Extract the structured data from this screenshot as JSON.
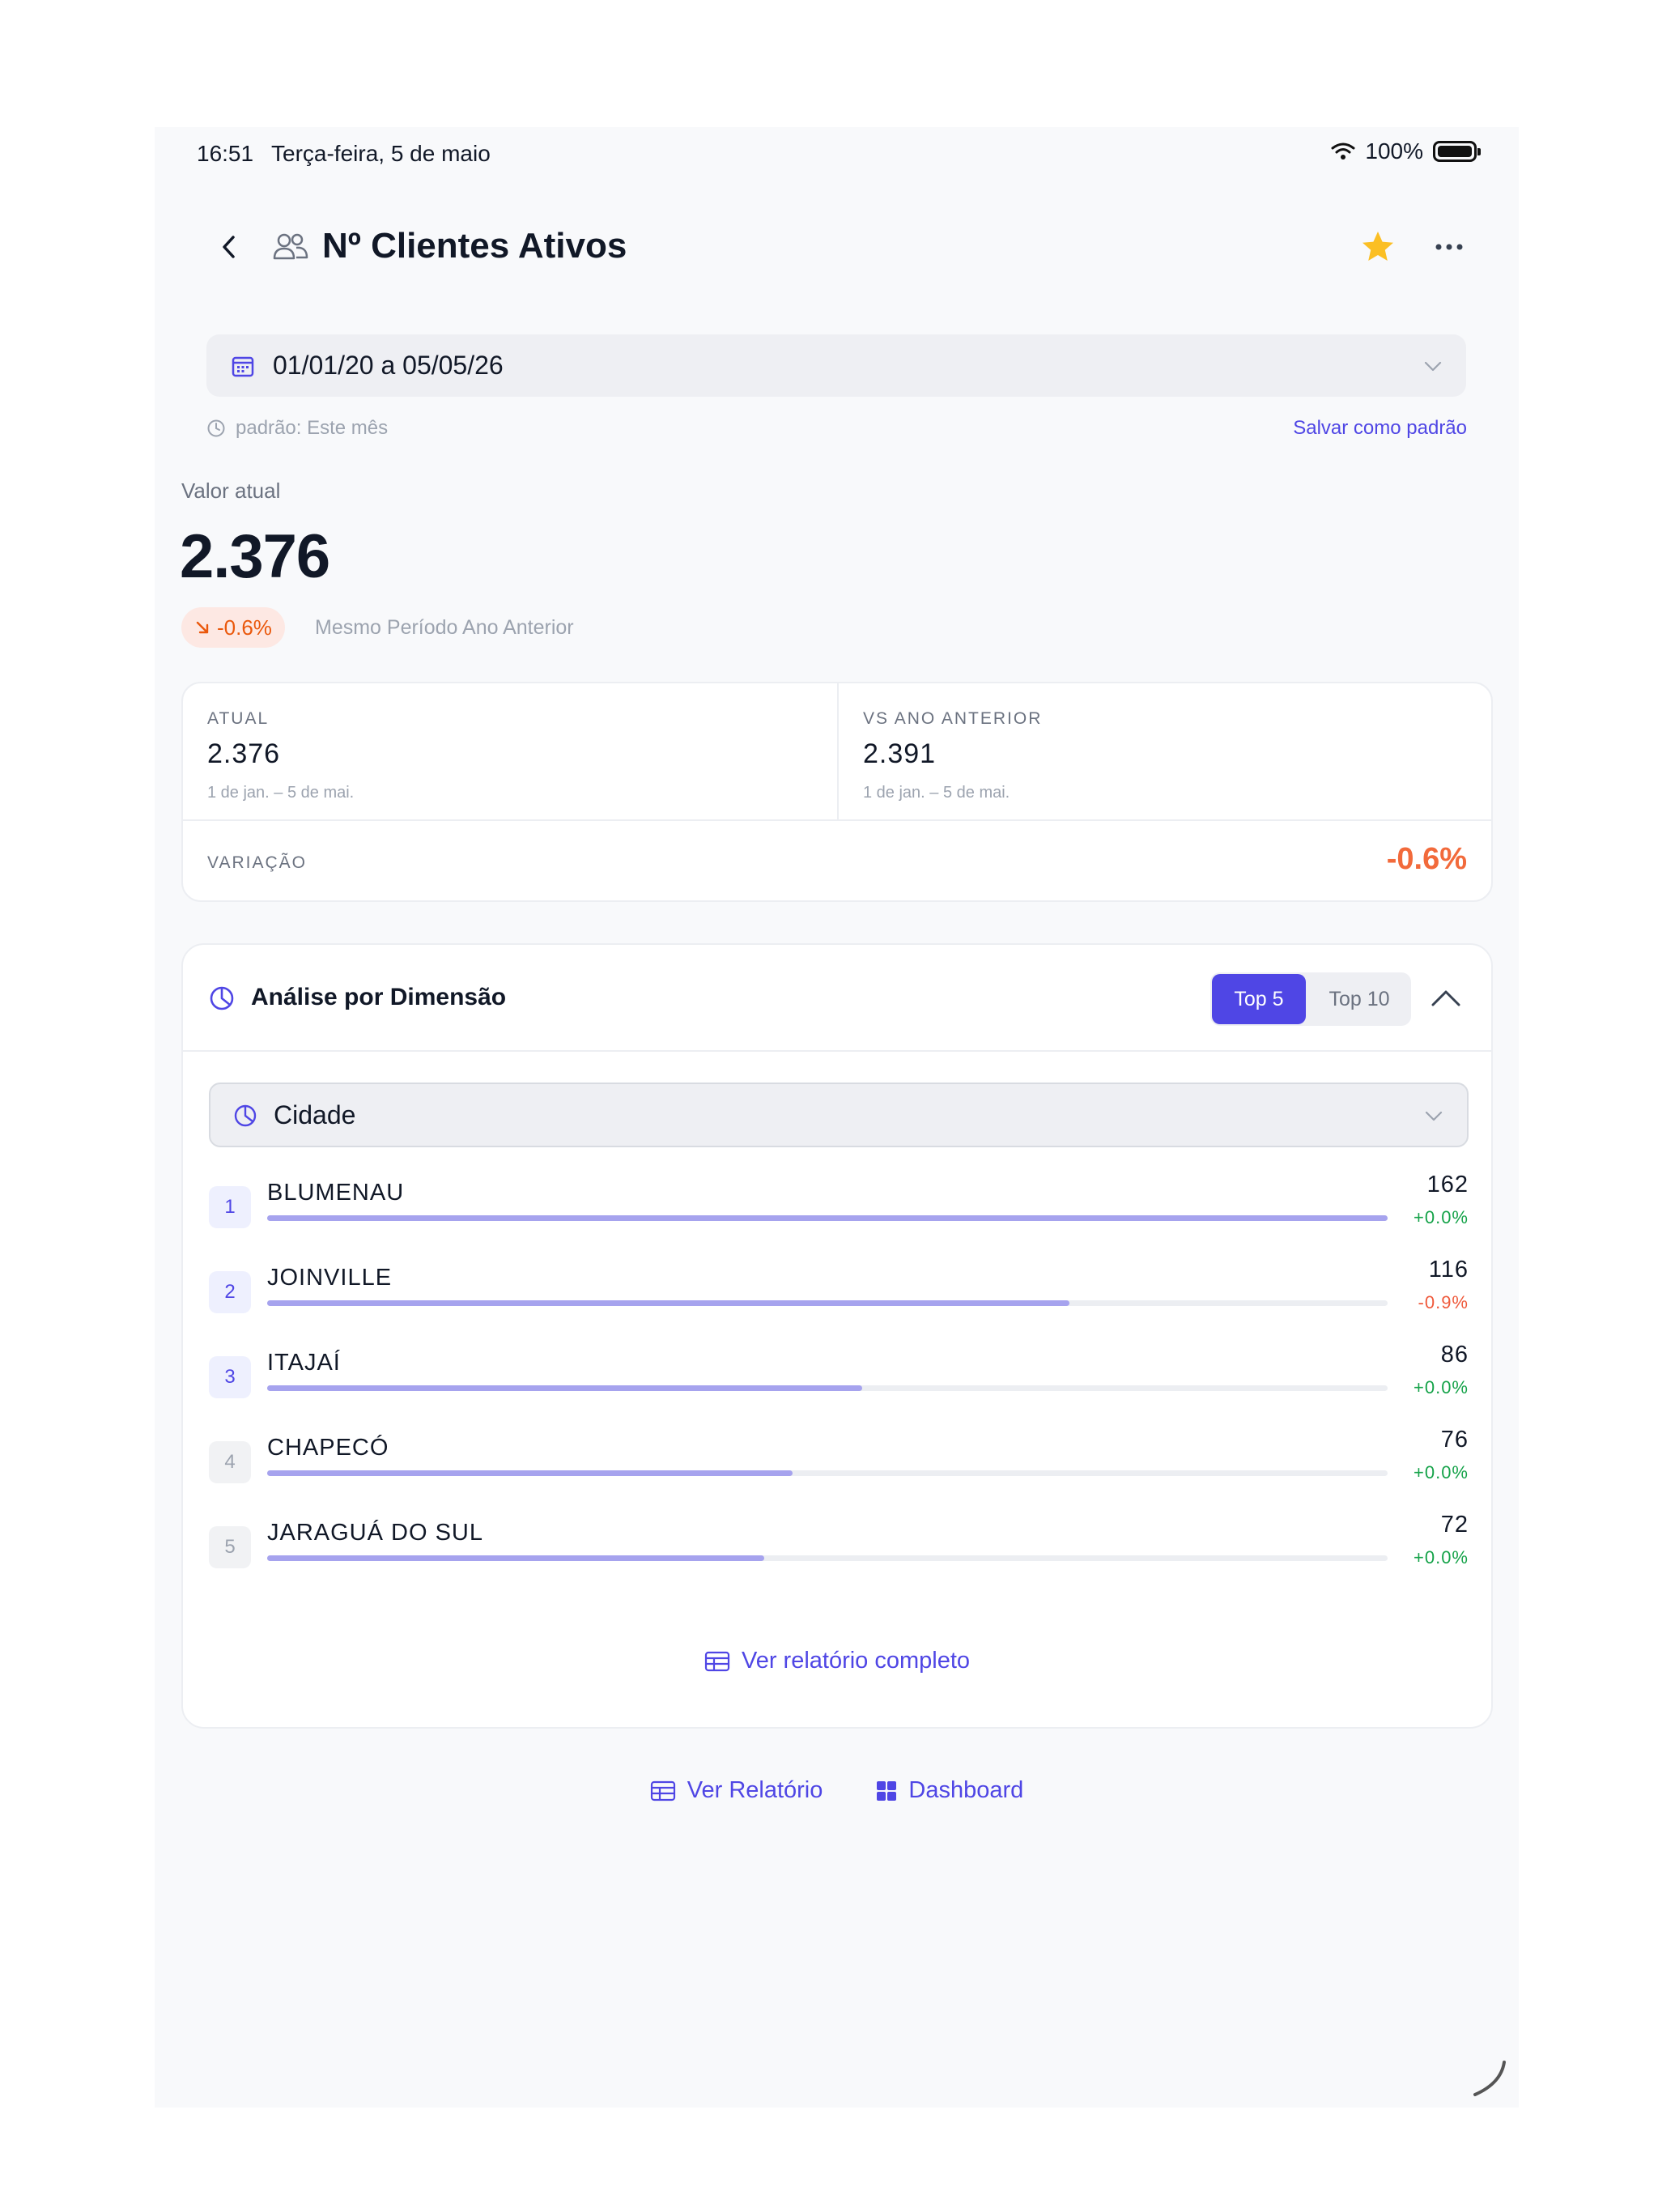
{
  "status": {
    "time": "16:51",
    "date": "Terça-feira, 5 de maio",
    "battery": "100%"
  },
  "header": {
    "title": "Nº Clientes Ativos",
    "star_color": "#fbbf24"
  },
  "date_range": {
    "value": "01/01/20 a 05/05/26",
    "default_note": "padrão: Este mês",
    "save_default": "Salvar como padrão"
  },
  "current": {
    "label": "Valor atual",
    "value": "2.376",
    "change": "-0.6%",
    "change_caption": "Mesmo Período Ano Anterior"
  },
  "comparison": {
    "actual_label": "ATUAL",
    "actual_value": "2.376",
    "actual_period": "1 de jan. – 5 de mai.",
    "prev_label": "VS ANO ANTERIOR",
    "prev_value": "2.391",
    "prev_period": "1 de jan. – 5 de mai.",
    "variation_label": "VARIAÇÃO",
    "variation_value": "-0.6%"
  },
  "dimension": {
    "title": "Análise por Dimensão",
    "tabs": [
      "Top 5",
      "Top 10"
    ],
    "selected_tab": "Top 5",
    "select_value": "Cidade",
    "accent": "#4f46e5",
    "rows": [
      {
        "rank": "1",
        "name": "BLUMENAU",
        "value": "162",
        "change": "+0.0%",
        "share": 1.0
      },
      {
        "rank": "2",
        "name": "JOINVILLE",
        "value": "116",
        "change": "-0.9%",
        "share": 0.716
      },
      {
        "rank": "3",
        "name": "ITAJAÍ",
        "value": "86",
        "change": "+0.0%",
        "share": 0.531
      },
      {
        "rank": "4",
        "name": "CHAPECÓ",
        "value": "76",
        "change": "+0.0%",
        "share": 0.469
      },
      {
        "rank": "5",
        "name": "JARAGUÁ DO SUL",
        "value": "72",
        "change": "+0.0%",
        "share": 0.444
      }
    ],
    "full_report": "Ver relatório completo"
  },
  "footer": {
    "report": "Ver Relatório",
    "dashboard": "Dashboard"
  }
}
